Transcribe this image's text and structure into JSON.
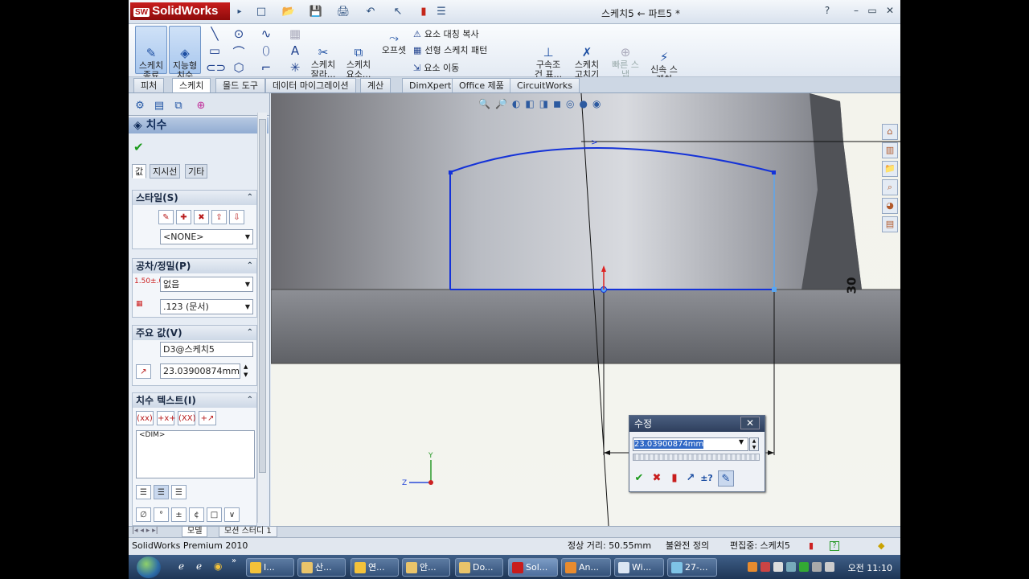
{
  "app": {
    "logo": "SolidWorks",
    "document_title": "스케치5 ← 파트5 *"
  },
  "quick_access": {
    "new_icon": "□",
    "open_icon": "📂",
    "save_icon": "💾",
    "print_icon": "🖨",
    "undo_icon": "↶",
    "select_icon": "↖",
    "rebuild_icon": "▮",
    "options_icon": "☰"
  },
  "window_controls": {
    "help": "?",
    "minimize": "–",
    "restore": "▭",
    "close": "✕"
  },
  "ribbon": {
    "exit_sketch": "스케치\n종료",
    "smart_dimension": "지능형\n치수",
    "trim": "스케치\n잘라...",
    "convert": "스케치\n요소...",
    "offset": "오프셋",
    "mirror": "요소 대칭 복사",
    "linear_pattern": "선형 스케치 패턴",
    "move": "요소 이동",
    "relations": "구속조\n건 표...",
    "repair": "스케치\n고치기",
    "quick_snaps": "빠른 스\n냅",
    "rapid_sketch": "신속 스\n케치"
  },
  "tabs": [
    {
      "label": "피처"
    },
    {
      "label": "스케치"
    },
    {
      "label": "몰드 도구"
    },
    {
      "label": "데이터 마이그레이션"
    },
    {
      "label": "계산"
    },
    {
      "label": "DimXpert"
    },
    {
      "label": "Office 제품"
    },
    {
      "label": "CircuitWorks"
    }
  ],
  "property_manager": {
    "title": "치수",
    "help": "?",
    "ok": "✔",
    "subtabs": [
      "값",
      "지시선",
      "기타"
    ],
    "style": {
      "header": "스타일(S)",
      "value": "<NONE>"
    },
    "tolerance": {
      "header": "공차/정밀(P)",
      "tol_icon_text": "1.50±.01",
      "tolerance_value": "없음",
      "precision_value": ".123 (문서)"
    },
    "primary_value": {
      "header": "주요 값(V)",
      "name": "D3@스케치5",
      "value": "23.03900874mm"
    },
    "dimension_text": {
      "header": "치수 텍스트(I)",
      "buttons": [
        "(xx)",
        "+x+",
        "(XX)",
        "+↗"
      ],
      "text": "<DIM>",
      "symbols": [
        "∅",
        "°",
        "±",
        "¢",
        "□",
        "∨"
      ]
    }
  },
  "bottom_tabs": [
    "모델",
    "모션 스터디 1"
  ],
  "status_bar": {
    "product": "SolidWorks Premium 2010",
    "distance": "정상 거리: 50.55mm",
    "state": "불완전 정의",
    "editing": "편집중: 스케치5"
  },
  "dimension_label": "30",
  "modify_dialog": {
    "title": "수정",
    "value": "23.03900874mm",
    "buttons": [
      "✔",
      "✖",
      "▮",
      "↗",
      "±?",
      "✎"
    ]
  },
  "taskbar": {
    "items": [
      "I...",
      "산...",
      "연...",
      "안...",
      "Do...",
      "Sol...",
      "An...",
      "Wi...",
      "27-..."
    ],
    "clock": "오전 11:10"
  },
  "colors": {
    "sketch": "#1432d8",
    "selected": "#5aa6f0",
    "ribbon_accent": "#1d4fa3"
  }
}
